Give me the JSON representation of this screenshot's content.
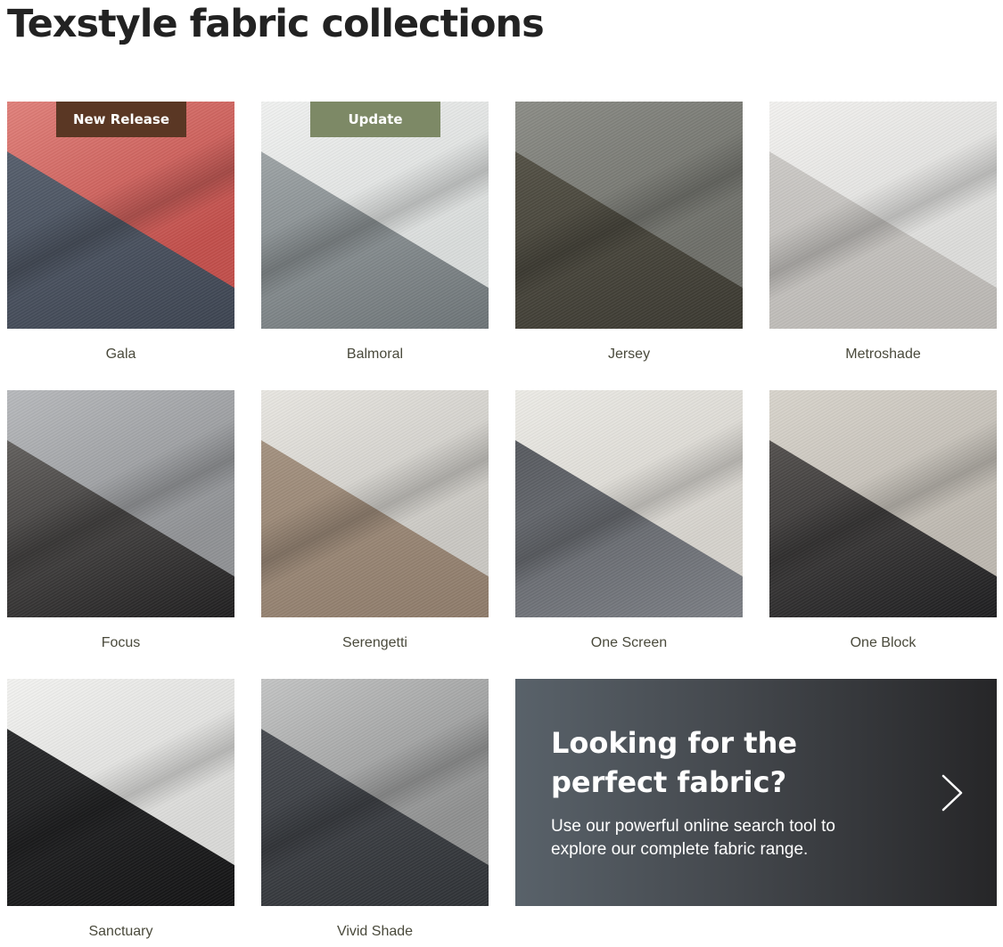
{
  "page": {
    "title": "Texstyle fabric collections"
  },
  "collections": [
    {
      "name": "Gala",
      "badge": "New Release",
      "badge_color": "#5a3724",
      "top": "#c14e4a",
      "bottom": "#5b6472",
      "top2": "#e0807a",
      "bottom2": "#3c4350"
    },
    {
      "name": "Balmoral",
      "badge": "Update",
      "badge_color": "#7d8966",
      "top": "#d9dcdb",
      "bottom": "#a7adaf",
      "top2": "#f0f1f0",
      "bottom2": "#6c7376"
    },
    {
      "name": "Jersey",
      "top": "#6d6e68",
      "bottom": "#585549",
      "top2": "#8b8c86",
      "bottom2": "#3a3830"
    },
    {
      "name": "Metroshade",
      "top": "#dcdcda",
      "bottom": "#cfcdca",
      "top2": "#f2f1ef",
      "bottom2": "#b9b6b2"
    },
    {
      "name": "Focus",
      "top": "#8f9194",
      "bottom": "#6f6c69",
      "top2": "#b7b9bc",
      "bottom2": "#1f1e1f"
    },
    {
      "name": "Serengetti",
      "top": "#c9c7c2",
      "bottom": "#a89684",
      "top2": "#e8e6e1",
      "bottom2": "#8d7a69"
    },
    {
      "name": "One Screen",
      "top": "#d5d2cc",
      "bottom": "#4f5257",
      "top2": "#ecebe6",
      "bottom2": "#7b7e84"
    },
    {
      "name": "One Block",
      "top": "#bdb8b0",
      "bottom": "#5e5a57",
      "top2": "#d8d4cc",
      "bottom2": "#1d1d1f"
    },
    {
      "name": "Sanctuary",
      "top": "#d9d9d7",
      "bottom": "#2c2d2f",
      "top2": "#f2f2f0",
      "bottom2": "#131314"
    },
    {
      "name": "Vivid Shade",
      "top": "#8e8f8f",
      "bottom": "#4b4e54",
      "top2": "#c3c4c4",
      "bottom2": "#2e3135"
    }
  ],
  "promo": {
    "heading": "Looking for the perfect fabric?",
    "text": "Use our powerful online search tool to explore our complete fabric range.",
    "chevron_icon": "chevron-right-icon"
  }
}
